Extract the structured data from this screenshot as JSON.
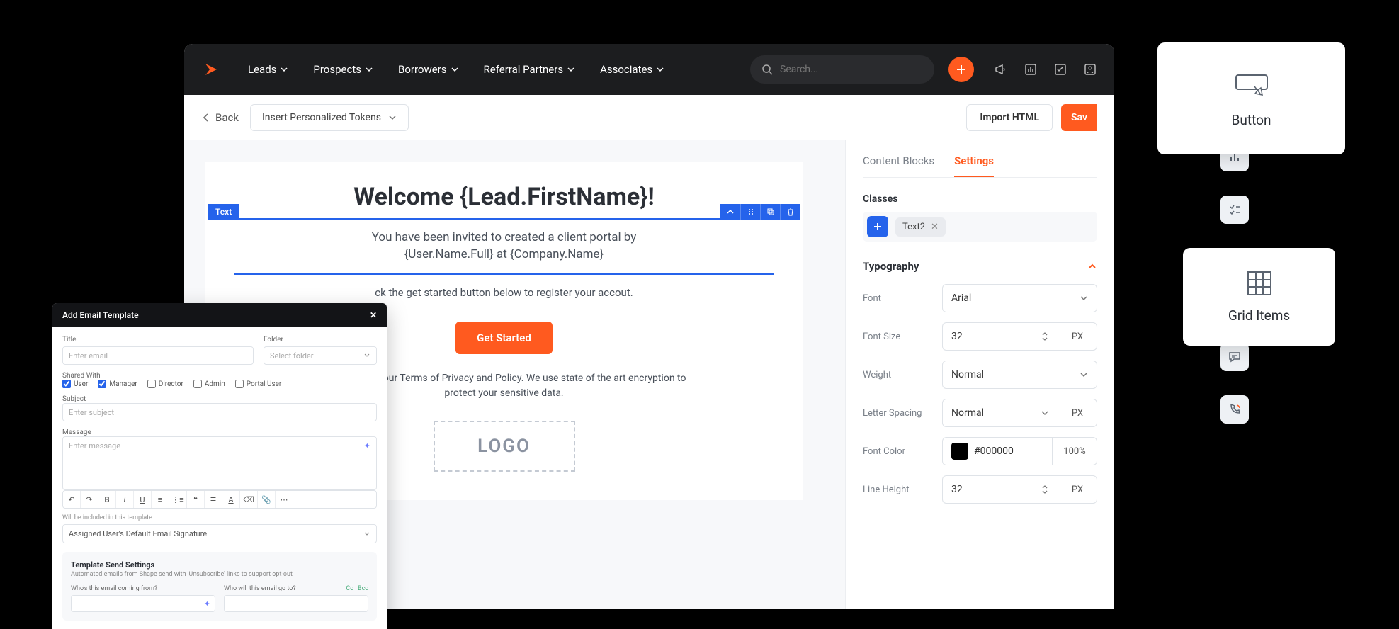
{
  "nav": {
    "items": [
      "Leads",
      "Prospects",
      "Borrowers",
      "Referral Partners",
      "Associates"
    ],
    "search_placeholder": "Search..."
  },
  "subbar": {
    "back": "Back",
    "tokens": "Insert Personalized Tokens",
    "import": "Import HTML",
    "save": "Sav"
  },
  "canvas": {
    "heading": "Welcome {Lead.FirstName}!",
    "text_tag": "Text",
    "invite_line1": "You have been invited to created a client portal by",
    "invite_line2": "{User.Name.Full} at {Company.Name}",
    "instruction": "ck the get started button below to register your accout.",
    "cta": "Get Started",
    "terms": ", you agree to our Terms of Privacy and Policy. We use state of the art encryption to protect your sensitive data.",
    "logo_placeholder": "LOGO"
  },
  "settings": {
    "tabs": {
      "blocks": "Content Blocks",
      "settings": "Settings"
    },
    "classes_label": "Classes",
    "class_chip": "Text2",
    "typography_label": "Typography",
    "props": {
      "font_label": "Font",
      "font_value": "Arial",
      "font_size_label": "Font Size",
      "font_size_value": "32",
      "font_size_unit": "PX",
      "weight_label": "Weight",
      "weight_value": "Normal",
      "letter_spacing_label": "Letter Spacing",
      "letter_spacing_value": "Normal",
      "letter_spacing_unit": "PX",
      "font_color_label": "Font Color",
      "font_color_value": "#000000",
      "font_color_pct": "100%",
      "line_height_label": "Line Height",
      "line_height_value": "32",
      "line_height_unit": "PX"
    }
  },
  "float": {
    "button": "Button",
    "grid": "Grid Items"
  },
  "modal": {
    "title": "Add Email Template",
    "title_label": "Title",
    "title_placeholder": "Enter email",
    "folder_label": "Folder",
    "folder_placeholder": "Select folder",
    "shared_label": "Shared With",
    "roles": [
      "User",
      "Manager",
      "Director",
      "Admin",
      "Portal User"
    ],
    "roles_checked": [
      true,
      true,
      false,
      false,
      false
    ],
    "subject_label": "Subject",
    "subject_placeholder": "Enter subject",
    "message_label": "Message",
    "message_placeholder": "Enter message",
    "include_label": "Will be included in this template",
    "signature": "Assigned User's Default Email Signature",
    "send_settings_title": "Template Send Settings",
    "send_settings_sub": "Automated emails from Shape send with 'Unsubscribe' links to support opt-out",
    "from_label": "Who's this email coming from?",
    "to_label": "Who will this email go to?",
    "cc": "Cc",
    "bcc": "Bcc"
  }
}
